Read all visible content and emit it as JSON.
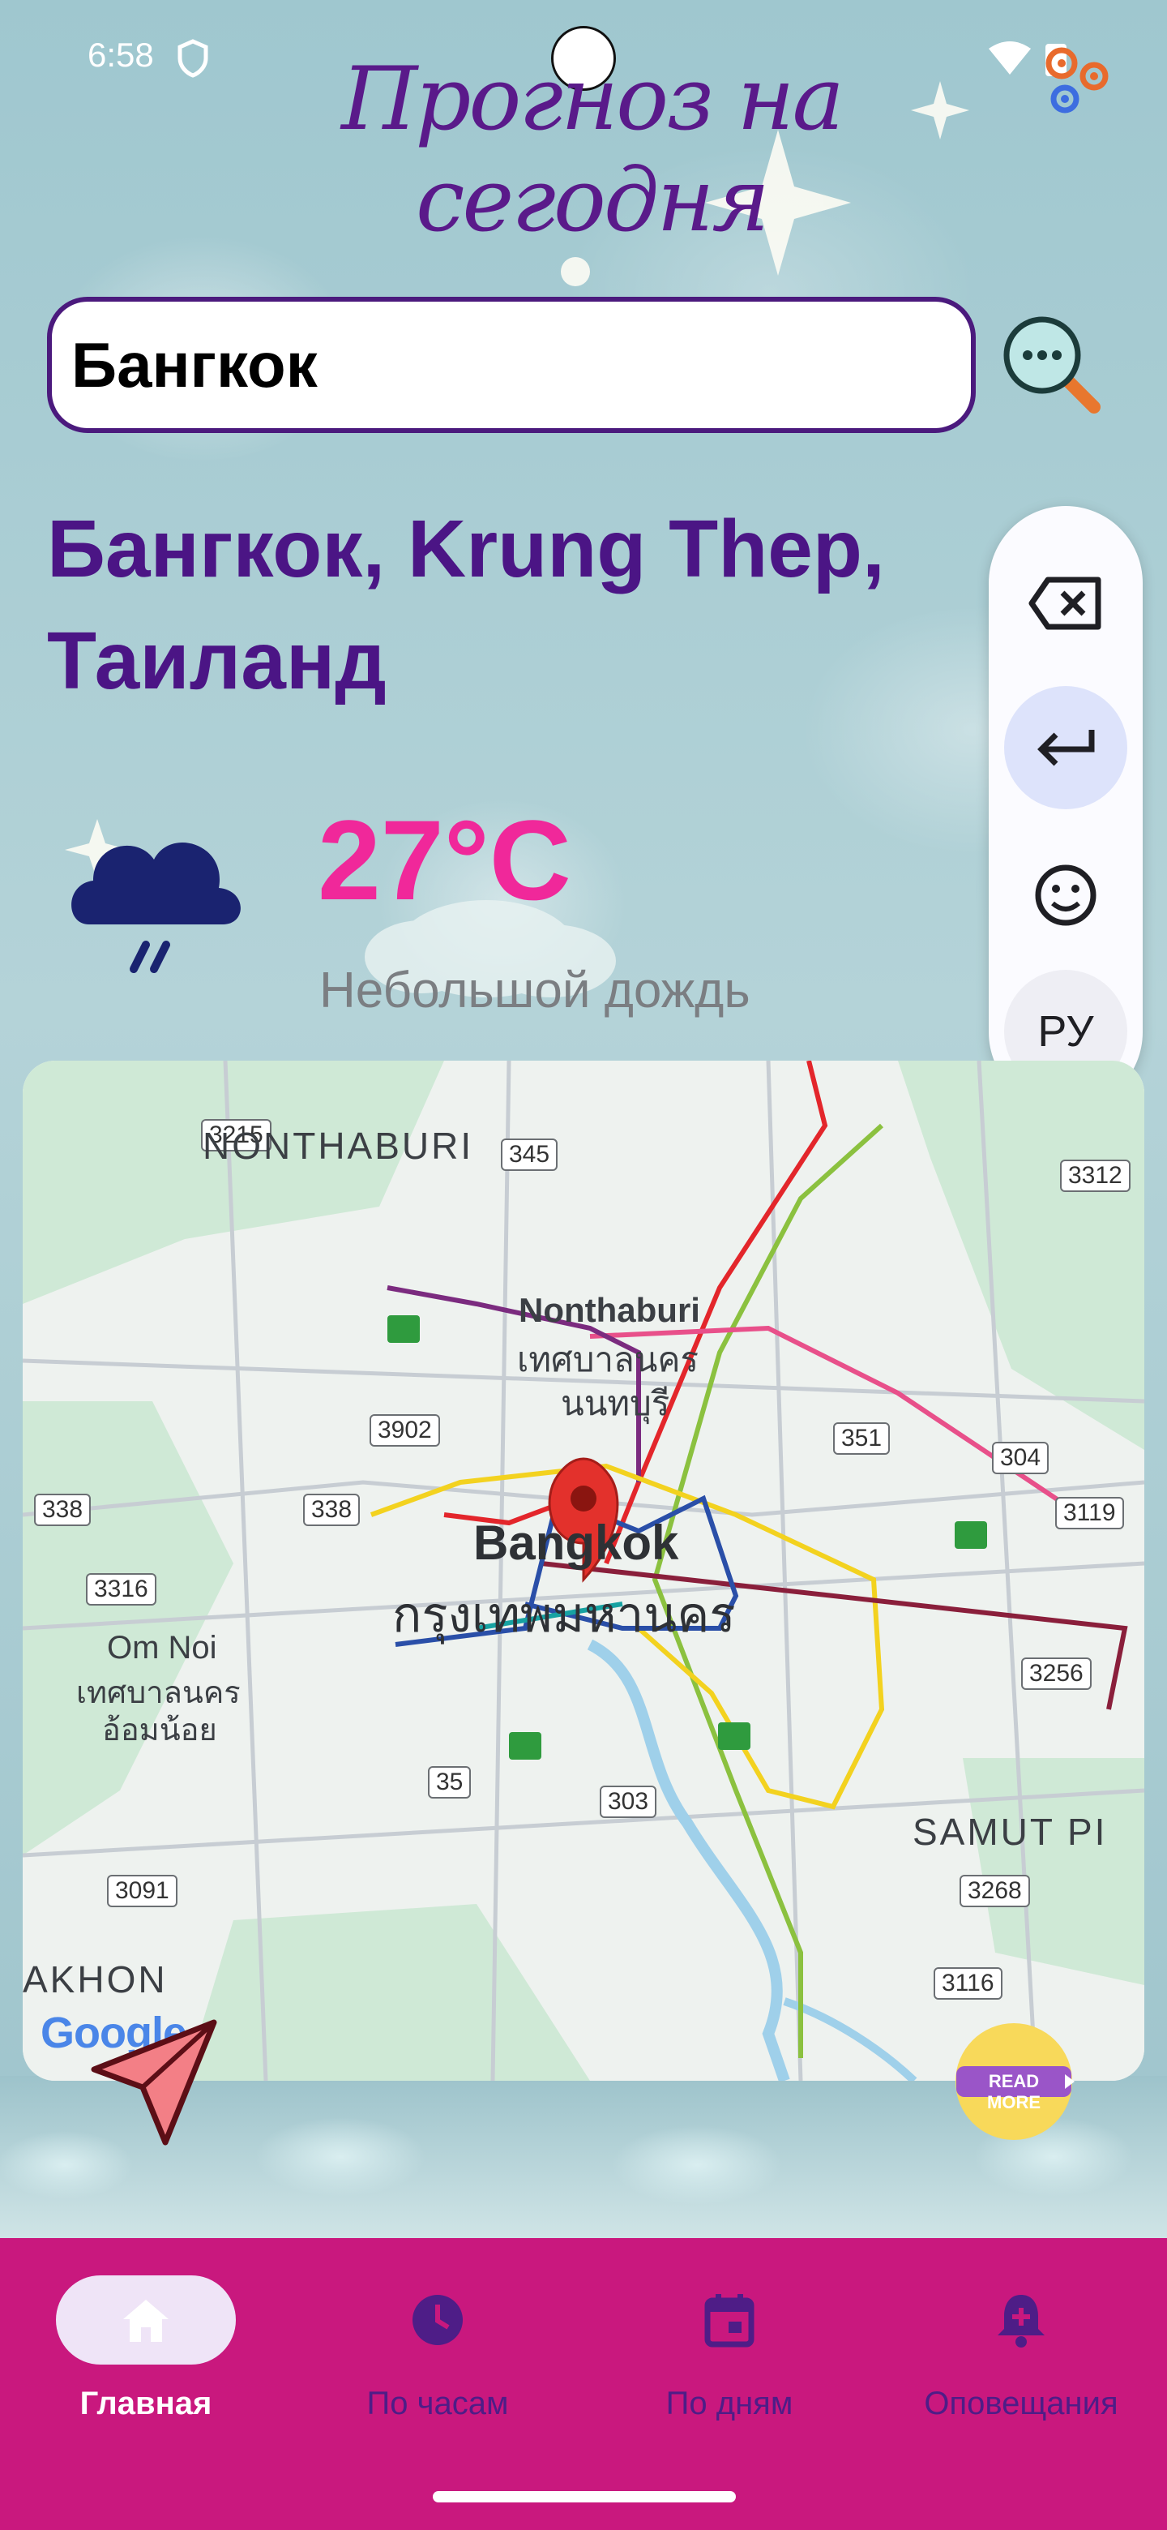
{
  "status_bar": {
    "time": "6:58"
  },
  "app": {
    "title": "Прогноз на сегодня"
  },
  "search": {
    "value": "Бангкок"
  },
  "location": {
    "name": "Бангкок, Krung Thep, Таиланд"
  },
  "weather": {
    "temperature": "27°C",
    "description": "Небольшой дождь",
    "icon": "rain-cloud-icon"
  },
  "keyboard_panel": {
    "buttons": [
      "backspace-icon",
      "enter-icon",
      "emoji-icon"
    ],
    "language": "РУ"
  },
  "map": {
    "labels": {
      "nonthaburi_province": "NONTHABURI",
      "nonthaburi": "Nonthaburi",
      "nonthaburi_thai_1": "เทศบาลนคร",
      "nonthaburi_thai_2": "นนทบุรี",
      "bangkok": "Bangkok",
      "bangkok_thai": "กรุงเทพมหานคร",
      "om_noi": "Om Noi",
      "om_noi_thai_1": "เทศบาลนคร",
      "om_noi_thai_2": "อ้อมน้อย",
      "samut": "SAMUT PI",
      "akhon": "AKHON",
      "google": "Google"
    },
    "road_numbers": [
      "3215",
      "345",
      "3312",
      "3902",
      "351",
      "304",
      "338",
      "338",
      "3119",
      "3316",
      "3256",
      "35",
      "303",
      "3268",
      "3091",
      "3116"
    ]
  },
  "read_more": {
    "label": "READ MORE"
  },
  "nav": {
    "items": [
      {
        "label": "Главная",
        "icon": "home-icon",
        "active": true
      },
      {
        "label": "По часам",
        "icon": "clock-icon",
        "active": false
      },
      {
        "label": "По дням",
        "icon": "calendar-icon",
        "active": false
      },
      {
        "label": "Оповещания",
        "icon": "bell-plus-icon",
        "active": false
      }
    ]
  },
  "colors": {
    "title": "#5a1a8a",
    "temperature": "#f0289a",
    "navbar": "#c9187e",
    "city": "#4b1585"
  }
}
